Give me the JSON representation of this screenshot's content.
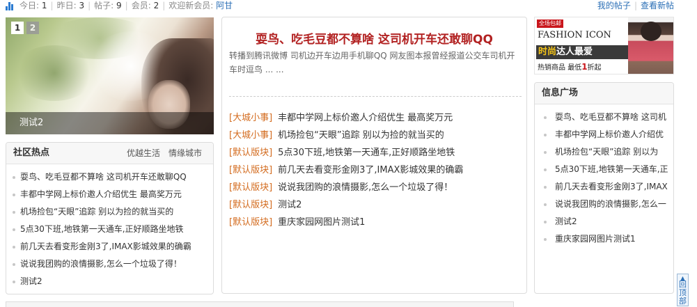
{
  "topbar": {
    "today_label": "今日:",
    "today_value": "1",
    "yesterday_label": "昨日:",
    "yesterday_value": "3",
    "posts_label": "帖子:",
    "posts_value": "9",
    "members_label": "会员:",
    "members_value": "2",
    "welcome_label": "欢迎新会员:",
    "newest_member": "阿甘",
    "my_posts": "我的帖子",
    "view_new": "查看新帖"
  },
  "slider": {
    "pages": [
      "1",
      "2"
    ],
    "active_page": "1",
    "caption": "测试2"
  },
  "hot": {
    "title": "社区热点",
    "tabs": [
      "优越生活",
      "情缘城市"
    ],
    "items": [
      "耍鸟、吃毛豆都不算啥 这司机开车还敢聊QQ",
      "丰都中学网上标价邀人介绍优生 最高奖万元",
      "机场捡包“天眼”追踪 别以为捡的就当买的",
      "5点30下班,地铁第一天通车,正好顺路坐地铁",
      "前几天去看变形金刚3了,IMAX影城效果的确霸",
      "说说我团购的浪情摄影,怎么一个垃圾了得！",
      "测试2"
    ]
  },
  "center": {
    "headline": "耍鸟、吃毛豆都不算啥 这司机开车还敢聊QQ",
    "summary": "转播到腾讯微博 司机边开车边用手机聊QQ 网友图本报曾经报道公交车司机开车时逗鸟 ... ...",
    "news": [
      {
        "cat": "[大城小事]",
        "title": "丰都中学网上标价邀人介绍优生 最高奖万元"
      },
      {
        "cat": "[大城小事]",
        "title": "机场捡包“天眼”追踪 别以为捡的就当买的"
      },
      {
        "cat": "[默认版块]",
        "title": "5点30下班,地铁第一天通车,正好顺路坐地铁"
      },
      {
        "cat": "[默认版块]",
        "title": "前几天去看变形金刚3了,IMAX影城效果的确霸"
      },
      {
        "cat": "[默认版块]",
        "title": "说说我团购的浪情摄影,怎么一个垃圾了得！"
      },
      {
        "cat": "[默认版块]",
        "title": "测试2"
      },
      {
        "cat": "[默认版块]",
        "title": "重庆家园网图片测试1"
      }
    ]
  },
  "ad": {
    "ribbon": "全场包邮",
    "brand": "FASHION ICON",
    "slogan_a": "时尚",
    "slogan_b": "达人最爱",
    "sub_a": "热销商品",
    "sub_b": "最低",
    "sub_c": "1",
    "sub_d": "折起"
  },
  "info": {
    "title": "信息广场",
    "items": [
      "耍鸟、吃毛豆都不算啥 这司机",
      "丰都中学网上标价邀人介绍优",
      "机场捡包“天眼”追踪 别以为",
      "5点30下班,地铁第一天通车,正",
      "前几天去看变形金刚3了,IMAX",
      "说说我团购的浪情摄影,怎么一",
      "测试2",
      "重庆家园网图片测试1"
    ]
  },
  "totop": {
    "label": "回顶部"
  }
}
